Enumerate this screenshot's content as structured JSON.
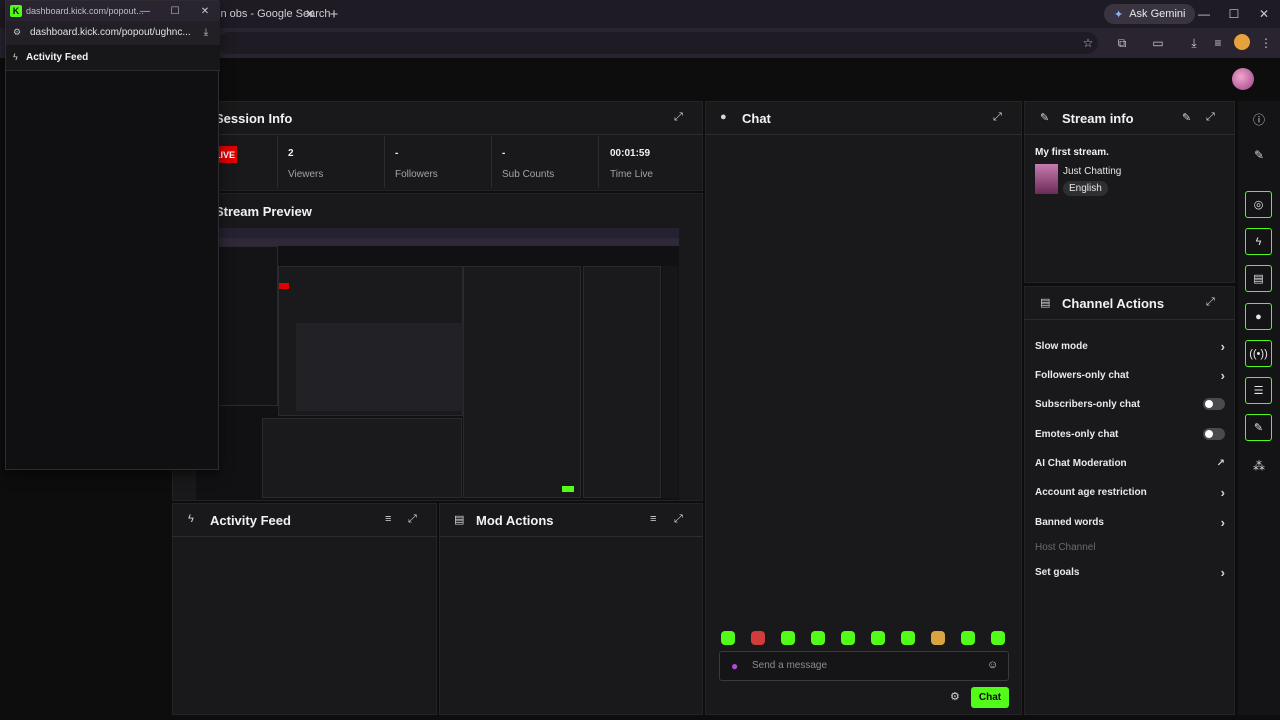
{
  "browser": {
    "tab_title": "in obs - Google Search",
    "ask_gemini": "Ask Gemini"
  },
  "popout": {
    "title": "dashboard.kick.com/popout...",
    "address": "dashboard.kick.com/popout/ughnc...",
    "feed_title": "Activity Feed"
  },
  "session": {
    "title": "Session Info",
    "live_badge": "LIVE",
    "stats": [
      {
        "value": "2",
        "label": "Viewers"
      },
      {
        "value": "-",
        "label": "Followers"
      },
      {
        "value": "-",
        "label": "Sub Counts"
      },
      {
        "value": "00:01:59",
        "label": "Time Live"
      }
    ]
  },
  "preview": {
    "title": "Stream Preview"
  },
  "chat": {
    "title": "Chat",
    "placeholder": "Send a message",
    "send_label": "Chat"
  },
  "stream_info": {
    "title": "Stream info",
    "stream_title": "My first stream.",
    "category": "Just Chatting",
    "language": "English"
  },
  "channel_actions": {
    "title": "Channel Actions",
    "items": [
      {
        "label": "Slow mode",
        "control": "chevron"
      },
      {
        "label": "Followers-only chat",
        "control": "chevron"
      },
      {
        "label": "Subscribers-only chat",
        "control": "toggle"
      },
      {
        "label": "Emotes-only chat",
        "control": "toggle"
      },
      {
        "label": "AI Chat Moderation",
        "control": "external"
      },
      {
        "label": "Account age restriction",
        "control": "chevron"
      },
      {
        "label": "Banned words",
        "control": "chevron"
      },
      {
        "label": "Host Channel",
        "control": "none"
      },
      {
        "label": "Set goals",
        "control": "chevron"
      }
    ]
  },
  "activity_feed": {
    "title": "Activity Feed"
  },
  "mod_actions": {
    "title": "Mod Actions"
  },
  "colors": {
    "accent": "#53fc18",
    "panel": "#19191b",
    "background": "#0d0d0e",
    "live": "#e00000"
  }
}
